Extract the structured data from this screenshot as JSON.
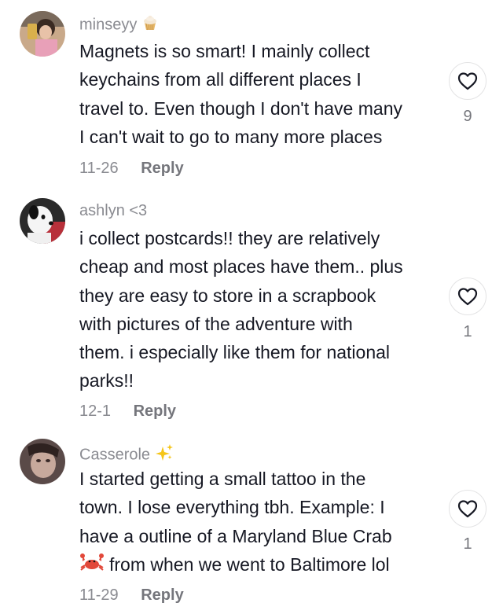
{
  "comments": [
    {
      "username": "minseyy",
      "username_emoji": "cupcake-icon",
      "lines": [
        "Magnets is so smart! I mainly collect",
        "keychains from all different places I",
        "travel to. Even though I don't have many",
        "I can't wait to go to many more places"
      ],
      "date": "11-26",
      "reply_label": "Reply",
      "likes": "9"
    },
    {
      "username": "ashlyn <3",
      "lines": [
        "i collect postcards!! they are relatively",
        "cheap and most places have them.. plus",
        "they are easy to store in a scrapbook",
        "with pictures of the adventure with",
        "them. i especially like them for national",
        "parks!!"
      ],
      "date": "12-1",
      "reply_label": "Reply",
      "likes": "1"
    },
    {
      "username": "Casserole",
      "username_emoji": "sparkles-icon",
      "lines": [
        "I started getting a small tattoo in the",
        "town. I lose everything tbh. Example: I",
        "have a outline of a Maryland Blue Crab",
        "from when we went to Baltimore lol"
      ],
      "inline_emoji": "crab-icon",
      "date": "11-29",
      "reply_label": "Reply",
      "likes": "1"
    }
  ],
  "colors": {
    "text": "#161823",
    "secondary": "#8a8b91",
    "reply": "#75767c",
    "heart_border": "#e3e3e4"
  }
}
